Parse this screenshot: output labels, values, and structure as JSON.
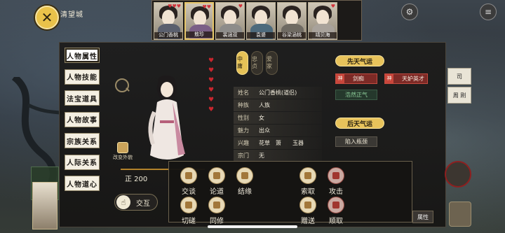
{
  "location": {
    "city_name": "清望城"
  },
  "close_icon": "close-x-icon",
  "top_icons": [
    "gear-icon",
    "menu-icon"
  ],
  "portraits": [
    {
      "name": "公门香桃",
      "tag": "",
      "hearts": "♥♥♥",
      "selected": false
    },
    {
      "name": "敖珍",
      "tag": "",
      "hearts": "♥♥",
      "selected": true
    },
    {
      "name": "裴涵双",
      "tag": "",
      "hearts": "♥",
      "selected": false
    },
    {
      "name": "袁婆",
      "tag": "",
      "hearts": "",
      "selected": false
    },
    {
      "name": "谷梁涵桃",
      "tag": "",
      "hearts": "",
      "selected": false
    },
    {
      "name": "靖贝海",
      "tag": "",
      "hearts": "♥",
      "selected": false
    }
  ],
  "side_tabs": [
    {
      "label": "人物属性",
      "active": true
    },
    {
      "label": "人物技能",
      "active": false
    },
    {
      "label": "法宝道具",
      "active": false
    },
    {
      "label": "人物故事",
      "active": false
    },
    {
      "label": "宗族关系",
      "active": false
    },
    {
      "label": "人际关系",
      "active": false
    },
    {
      "label": "人物道心",
      "active": false
    }
  ],
  "alignment": [
    {
      "label": "中庸",
      "active": true
    },
    {
      "label": "忠贞",
      "active": false
    },
    {
      "label": "爱家",
      "active": false
    }
  ],
  "hearts_column": [
    "♥",
    "♥",
    "♥",
    "♥",
    "♥",
    "♥"
  ],
  "info": [
    {
      "key": "姓名",
      "value": "公门香桃(道侣)"
    },
    {
      "key": "种族",
      "value": "人族"
    },
    {
      "key": "性别",
      "value": "女"
    },
    {
      "key": "魅力",
      "value": "出众"
    },
    {
      "key": "兴趣",
      "value": "花草　箫　　玉器"
    }
  ],
  "change_look_label": "改变外貌",
  "stat_value": "正 200",
  "interact_label": "交互",
  "innate_luck": {
    "title": "先天气运",
    "traits": [
      {
        "label": "剑痴",
        "type": "red",
        "mark": "神"
      },
      {
        "label": "天妒英才",
        "type": "red",
        "mark": "神"
      },
      {
        "label": "浩然正气",
        "type": "green",
        "mark": ""
      }
    ]
  },
  "acquired_luck": {
    "title": "后天气运",
    "traits": [
      {
        "label": "陷入瓶颈",
        "type": "gray"
      }
    ]
  },
  "actions": [
    {
      "label": "交谈",
      "hostile": false
    },
    {
      "label": "论道",
      "hostile": false
    },
    {
      "label": "结缘",
      "hostile": false
    },
    {
      "label": "索取",
      "hostile": false
    },
    {
      "label": "攻击",
      "hostile": true
    },
    {
      "label": "切磋",
      "hostile": false
    },
    {
      "label": "同修",
      "hostile": false
    },
    {
      "label": "赠送",
      "hostile": false
    },
    {
      "label": "顺取",
      "hostile": true
    }
  ],
  "attr_button_label": "属性",
  "sect_row": {
    "key": "宗门",
    "value": "无"
  },
  "side_card_a": "司",
  "side_card_b": "周\n刚"
}
